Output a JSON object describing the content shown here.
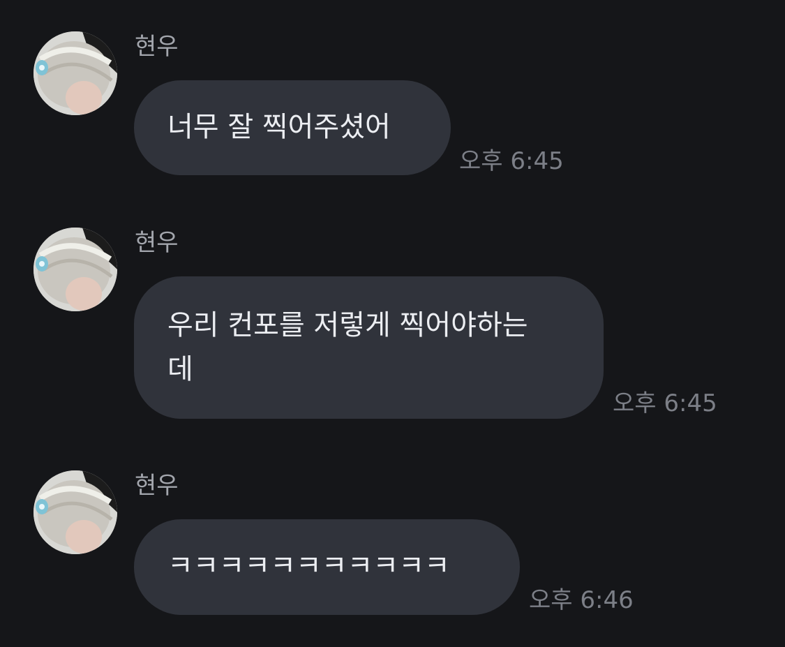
{
  "messages": [
    {
      "sender": "현우",
      "text": "너무 잘 찍어주셨어",
      "time": "오후 6:45"
    },
    {
      "sender": "현우",
      "text": "우리 컨포를 저렇게 찍어야하는\n데",
      "time": "오후 6:45"
    },
    {
      "sender": "현우",
      "text": "ㅋㅋㅋㅋㅋㅋㅋㅋㅋㅋㅋ",
      "time": "오후 6:46"
    }
  ],
  "colors": {
    "background": "#151619",
    "bubble": "#30333b",
    "text": "#eceef2",
    "sender": "#a3a6ad",
    "time": "#7c7f87"
  }
}
